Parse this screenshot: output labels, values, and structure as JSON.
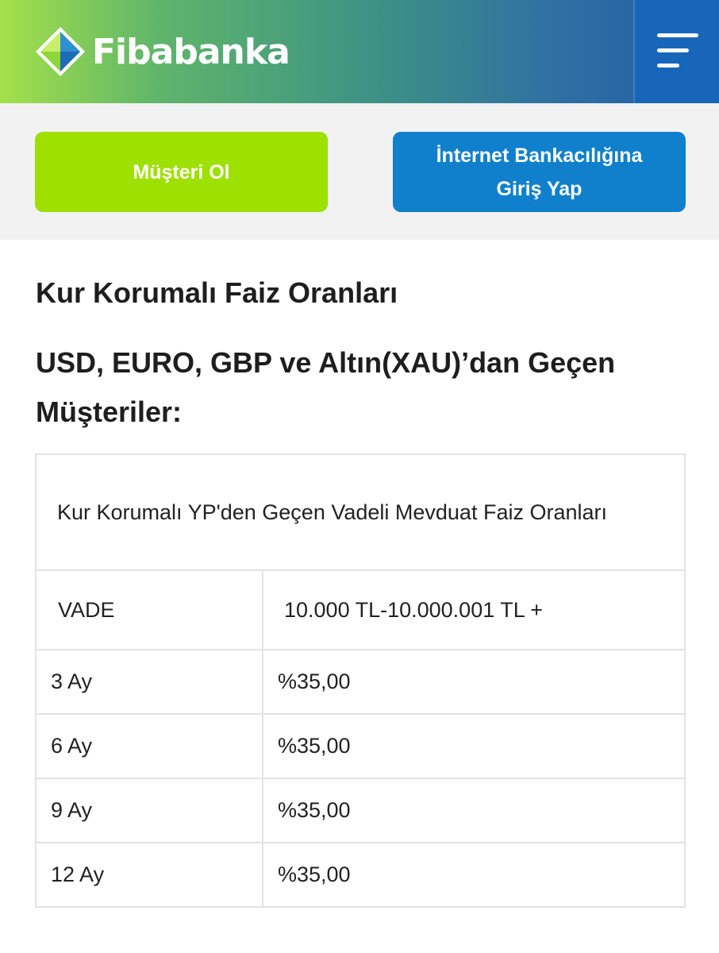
{
  "header": {
    "brand_name": "Fibabanka",
    "logo_icon": "fibabanka-diamond-logo",
    "menu_icon": "hamburger-menu-icon",
    "colors": {
      "gradient_start": "#a5e04a",
      "gradient_end": "#1f5ba8",
      "menu_bg": "#1766b9"
    }
  },
  "actions": {
    "customer_button": "Müşteri Ol",
    "internet_banking_button_line1": "İnternet Bankacılığına",
    "internet_banking_button_line2": "Giriş Yap",
    "colors": {
      "green": "#9ee000",
      "blue": "#1080cc"
    }
  },
  "content": {
    "title": "Kur Korumalı Faiz Oranları",
    "subtitle": "USD, EURO, GBP ve Altın(XAU)’dan Geçen Müşteriler:"
  },
  "table": {
    "caption": "Kur Korumalı YP'den Geçen Vadeli Mevduat Faiz Oranları",
    "headers": [
      "VADE",
      "10.000 TL-10.000.001 TL +"
    ],
    "rows": [
      {
        "term": "3 Ay",
        "rate": "%35,00"
      },
      {
        "term": "6 Ay",
        "rate": "%35,00"
      },
      {
        "term": "9 Ay",
        "rate": "%35,00"
      },
      {
        "term": "12 Ay",
        "rate": "%35,00"
      }
    ]
  }
}
